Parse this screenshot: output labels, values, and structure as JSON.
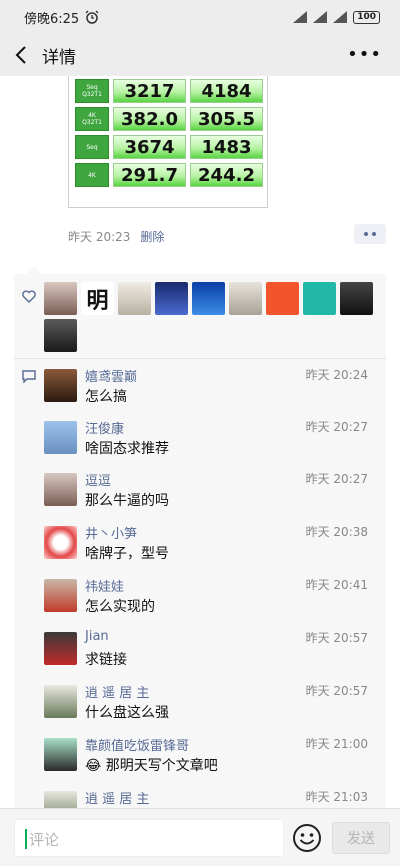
{
  "status_bar": {
    "time": "傍晚6:25",
    "battery": "100"
  },
  "header": {
    "title": "详情"
  },
  "benchmark": {
    "rows": [
      {
        "label": "Seq\nQ32T1",
        "read": "3217",
        "write": "4184"
      },
      {
        "label": "4K\nQ32T1",
        "read": "382.0",
        "write": "305.5"
      },
      {
        "label": "Seq",
        "read": "3674",
        "write": "1483"
      },
      {
        "label": "4K",
        "read": "291.7",
        "write": "244.2"
      }
    ]
  },
  "post": {
    "time": "昨天 20:23",
    "delete_label": "删除"
  },
  "likes": {
    "avatars": [
      "skull",
      "明",
      "cartoon",
      "anime",
      "windows",
      "desert",
      "orange",
      "frog",
      "dark",
      "joker"
    ]
  },
  "comments": [
    {
      "name": "嬉鸢雲巅",
      "time": "昨天 20:24",
      "text": "怎么搞"
    },
    {
      "name": "汪俊康",
      "time": "昨天 20:27",
      "text": "啥固态求推荐"
    },
    {
      "name": "逗逗",
      "time": "昨天 20:27",
      "text": "那么牛逼的吗"
    },
    {
      "name": "井丶小笋",
      "time": "昨天 20:38",
      "text": "啥牌子，型号"
    },
    {
      "name": "祎娃娃",
      "time": "昨天 20:41",
      "text": "怎么实现的"
    },
    {
      "name": "Jian",
      "time": "昨天 20:57",
      "text": "求链接"
    },
    {
      "name": "逍 遥 居 主",
      "time": "昨天 20:57",
      "text": "什么盘这么强"
    },
    {
      "name": "靠颜值吃饭雷锋哥",
      "time": "昨天 21:00",
      "text": "😂 那明天写个文章吧"
    },
    {
      "name": "逍 遥 居 主",
      "time": "昨天 21:03",
      "text": ""
    }
  ],
  "input": {
    "placeholder": "评论",
    "send_label": "发送"
  },
  "colors": {
    "link": "#576b95",
    "accent": "#06ae56"
  }
}
